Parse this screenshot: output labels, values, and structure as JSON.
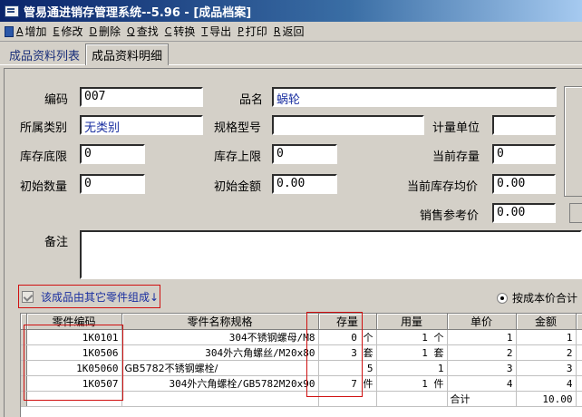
{
  "window": {
    "title": "管易通进销存管理系统--5.96 - [成品档案]"
  },
  "toolbar": [
    {
      "key": "A",
      "label": "增加",
      "icon": "add-icon"
    },
    {
      "key": "E",
      "label": "修改",
      "icon": "edit-icon"
    },
    {
      "key": "D",
      "label": "删除",
      "icon": "delete-icon"
    },
    {
      "key": "Q",
      "label": "查找",
      "icon": "search-icon"
    },
    {
      "key": "C",
      "label": "转换",
      "icon": "convert-icon"
    },
    {
      "key": "T",
      "label": "导出",
      "icon": "export-icon"
    },
    {
      "key": "P",
      "label": "打印",
      "icon": "print-icon"
    },
    {
      "key": "R",
      "label": "返回",
      "icon": "return-icon"
    }
  ],
  "tabs": [
    {
      "label": "成品资料列表",
      "active": false
    },
    {
      "label": "成品资料明细",
      "active": true
    }
  ],
  "form": {
    "code_label": "编码",
    "code_value": "007",
    "name_label": "品名",
    "name_value": "蜗轮",
    "category_label": "所属类别",
    "category_value": "无类别",
    "spec_label": "规格型号",
    "spec_value": "",
    "unit_label": "计量单位",
    "unit_value": "",
    "stock_min_label": "库存底限",
    "stock_min_value": "0",
    "stock_max_label": "库存上限",
    "stock_max_value": "0",
    "current_stock_label": "当前存量",
    "current_stock_value": "0",
    "initial_qty_label": "初始数量",
    "initial_qty_value": "0",
    "initial_amount_label": "初始金额",
    "initial_amount_value": "0.00",
    "avg_price_label": "当前库存均价",
    "avg_price_value": "0.00",
    "sale_price_label": "销售参考价",
    "sale_price_value": "0.00",
    "remark_label": "备注",
    "remark_value": ""
  },
  "composed_checkbox": {
    "label": "该成品由其它零件组成↓",
    "checked": true
  },
  "cost_radio": {
    "label": "按成本价合计",
    "selected": true
  },
  "parts_table": {
    "headers": [
      "零件编码",
      "零件名称规格",
      "存量",
      "用量",
      "单价",
      "金额"
    ],
    "rows": [
      {
        "code": "1K0101",
        "name": "304不锈钢螺母/M8",
        "stock": "0 个",
        "usage": "1 个",
        "price": "1",
        "amount": "1"
      },
      {
        "code": "1K0506",
        "name": "304外六角螺丝/M20x80",
        "stock": "3 套",
        "usage": "1 套",
        "price": "2",
        "amount": "2"
      },
      {
        "code": "1K05060",
        "name": "GB5782不锈钢螺栓/",
        "stock": "5",
        "usage": "1",
        "price": "3",
        "amount": "3"
      },
      {
        "code": "1K0507",
        "name": "304外六角螺栓/GB5782M20x90",
        "stock": "7 件",
        "usage": "1 件",
        "price": "4",
        "amount": "4"
      }
    ],
    "total_label": "合计",
    "total_value": "10.00"
  },
  "colors": {
    "title_bar": "#0a246a",
    "window_bg": "#d4d0c8",
    "highlight_box": "#d01010",
    "value_text": "#1a2fa0"
  }
}
